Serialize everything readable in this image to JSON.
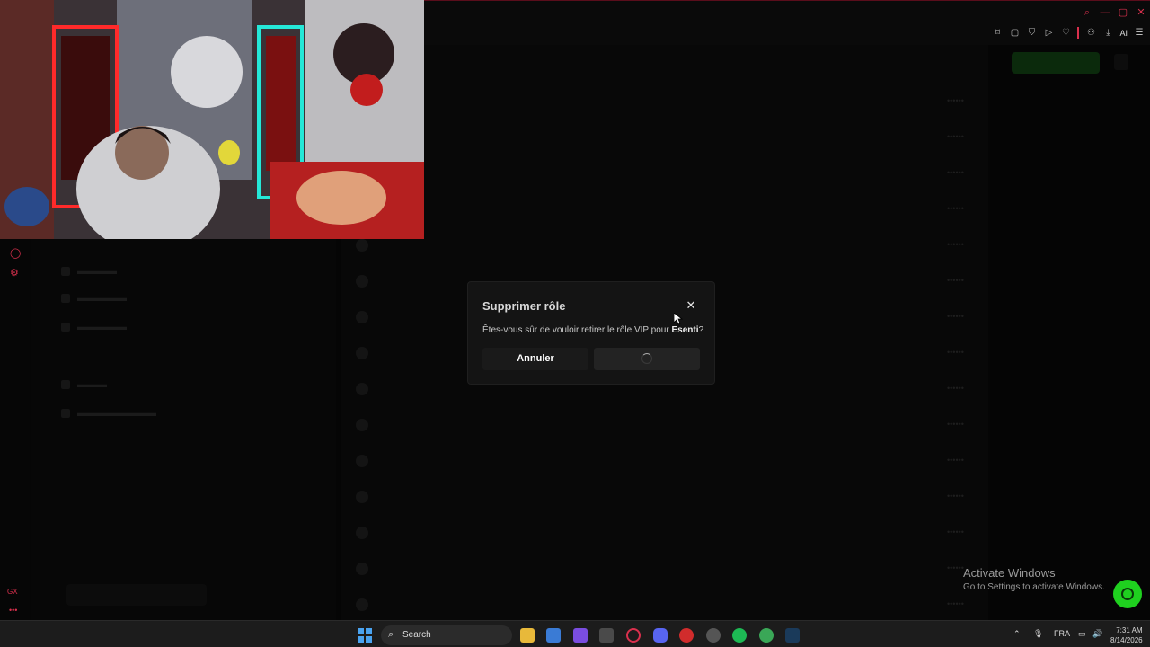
{
  "modal": {
    "title": "Supprimer rôle",
    "message_prefix": "Êtes-vous sûr de vouloir retirer le rôle VIP pour ",
    "username": "Esenti",
    "message_suffix": "?",
    "cancel_label": "Annuler",
    "close_icon": "close-icon",
    "confirm_state": "loading"
  },
  "topbar": {
    "ai_label": "AI"
  },
  "overlay_watermark": {
    "line1": "Activate Windows",
    "line2": "Go to Settings to activate Windows."
  },
  "taskbar": {
    "search_label": "Search",
    "language": "FRA",
    "time": "7:31 AM",
    "date": "8/14/2026"
  },
  "left_rail": {
    "bottom_label": "GX"
  },
  "colors": {
    "accent": "#d9304d",
    "help_button": "#1fd01f",
    "modal_bg": "#141414"
  }
}
